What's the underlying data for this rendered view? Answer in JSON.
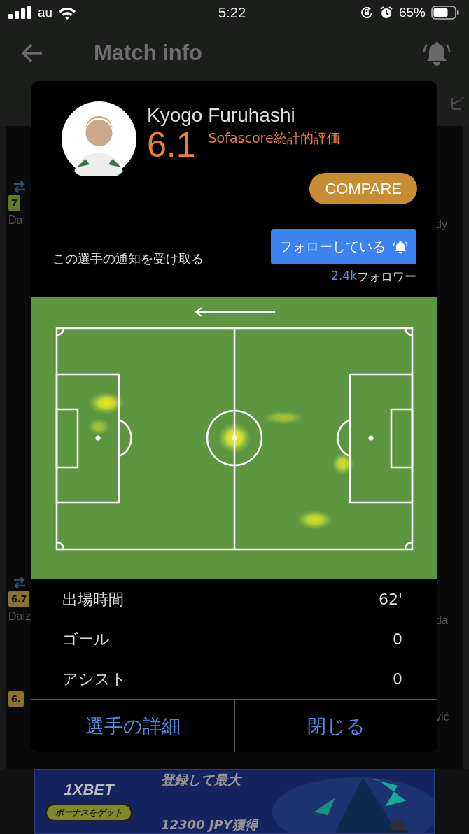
{
  "status_bar": {
    "carrier": "au",
    "time": "5:22",
    "battery": "65%"
  },
  "header": {
    "title": "Match info"
  },
  "background": {
    "tab_fragment": "ビ",
    "left": [
      {
        "kind": "badge",
        "text": "7",
        "color": "#5f7a2a"
      },
      {
        "kind": "name",
        "text": "Da"
      },
      {
        "kind": "badge",
        "text": "6.7",
        "color": "#8a7230"
      },
      {
        "kind": "name",
        "text": "Daiz"
      },
      {
        "kind": "badge",
        "text": "6.",
        "color": "#8a7230"
      }
    ],
    "right": [
      {
        "text": "dy"
      },
      {
        "text": "da"
      },
      {
        "text": "vić"
      }
    ]
  },
  "player_dialog": {
    "name": "Kyogo Furuhashi",
    "rating": "6.1",
    "rating_label": "Sofascore統計的評価",
    "compare_button": "COMPARE",
    "notify_text": "この選手の通知を受け取る",
    "follow_button": {
      "label": "フォローしている",
      "selected": true
    },
    "followers_count": "2.4k",
    "followers_label": "フォロワー",
    "stats": [
      {
        "label": "出場時間",
        "value": "62'"
      },
      {
        "label": "ゴール",
        "value": "0"
      },
      {
        "label": "アシスト",
        "value": "0"
      }
    ],
    "buttons": [
      "選手の詳細",
      "閉じる"
    ]
  },
  "ad": {
    "logo": "1XBET",
    "button": "ボーナスをゲット",
    "headline": "登録して最大",
    "amount": "12300 JPY獲得"
  }
}
